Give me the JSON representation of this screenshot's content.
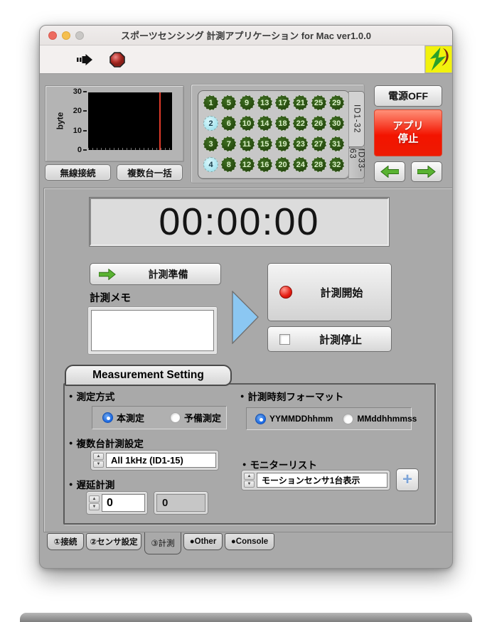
{
  "window": {
    "title": "スポーツセンシング 計測アプリケーション for Mac ver1.0.0"
  },
  "toolbar": {
    "run_icon": "run-arrow-icon",
    "stop_icon": "stop-icon",
    "logo_icon": "sports-sensing-logo"
  },
  "colors": {
    "app_stop_red": "#f31400",
    "selected_radio_blue": "#1c6ae4",
    "sensor_green": "#2c5212",
    "sensor_cyan": "#b7ebf4",
    "logo_yellow": "#f2f20c",
    "cursor_red": "#e03a2a"
  },
  "byte_chart": {
    "ylabel": "byte",
    "yticks": [
      "30",
      "20",
      "10",
      "0"
    ],
    "cursor_position_pct": 85
  },
  "chart_data": {
    "type": "line",
    "title": "",
    "xlabel": "",
    "ylabel": "byte",
    "ylim": [
      0,
      30
    ],
    "series": [],
    "annotations": [
      "red vertical cursor near right edge of empty black plot"
    ]
  },
  "connection": {
    "wireless_label": "無線接続",
    "multi_label": "複数台一括"
  },
  "sensor_grid": {
    "numbers": [
      [
        1,
        5,
        9,
        13,
        17,
        21,
        25,
        29
      ],
      [
        2,
        6,
        10,
        14,
        18,
        22,
        26,
        30
      ],
      [
        3,
        7,
        11,
        15,
        19,
        23,
        27,
        31
      ],
      [
        4,
        8,
        12,
        16,
        20,
        24,
        28,
        32
      ]
    ],
    "highlighted_ids": [
      2,
      4
    ],
    "tabs": [
      {
        "label": "ID1-32",
        "active": true
      },
      {
        "label": "ID33-63",
        "active": false
      }
    ]
  },
  "power": {
    "off_label": "電源OFF",
    "app_stop_line1": "アプリ",
    "app_stop_line2": "停止"
  },
  "nav": {
    "prev_icon": "green-left-arrow-icon",
    "next_icon": "green-right-arrow-icon"
  },
  "timer": {
    "value": "00:00:00"
  },
  "measurement": {
    "prepare_label": "計測準備",
    "memo_label": "計測メモ",
    "memo_value": "",
    "start_label": "計測開始",
    "stop_label": "計測停止"
  },
  "settings": {
    "header": "Measurement Setting",
    "bullet": "●",
    "method": {
      "label": "測定方式",
      "options": [
        {
          "label": "本測定",
          "selected": true
        },
        {
          "label": "予備測定",
          "selected": false
        }
      ]
    },
    "time_format": {
      "label": "計測時刻フォーマット",
      "options": [
        {
          "label": "YYMMDDhhmm",
          "selected": true
        },
        {
          "label": "MMddhhmmss",
          "selected": false
        }
      ]
    },
    "multi_measure": {
      "label": "複数台計測設定",
      "value": "All 1kHz (ID1-15)"
    },
    "monitor_list": {
      "label": "モニターリスト",
      "value": "モーションセンサ1台表示",
      "add_button": "+"
    },
    "delay": {
      "label": "遅延計測",
      "value": "0",
      "readout": "0"
    }
  },
  "footer_tabs": {
    "items": [
      {
        "label": "①接続",
        "active": false
      },
      {
        "label": "②センサ設定",
        "active": false
      },
      {
        "label": "③計測",
        "active": true
      },
      {
        "label": "●Other",
        "active": false
      },
      {
        "label": "●Console",
        "active": false
      }
    ]
  }
}
